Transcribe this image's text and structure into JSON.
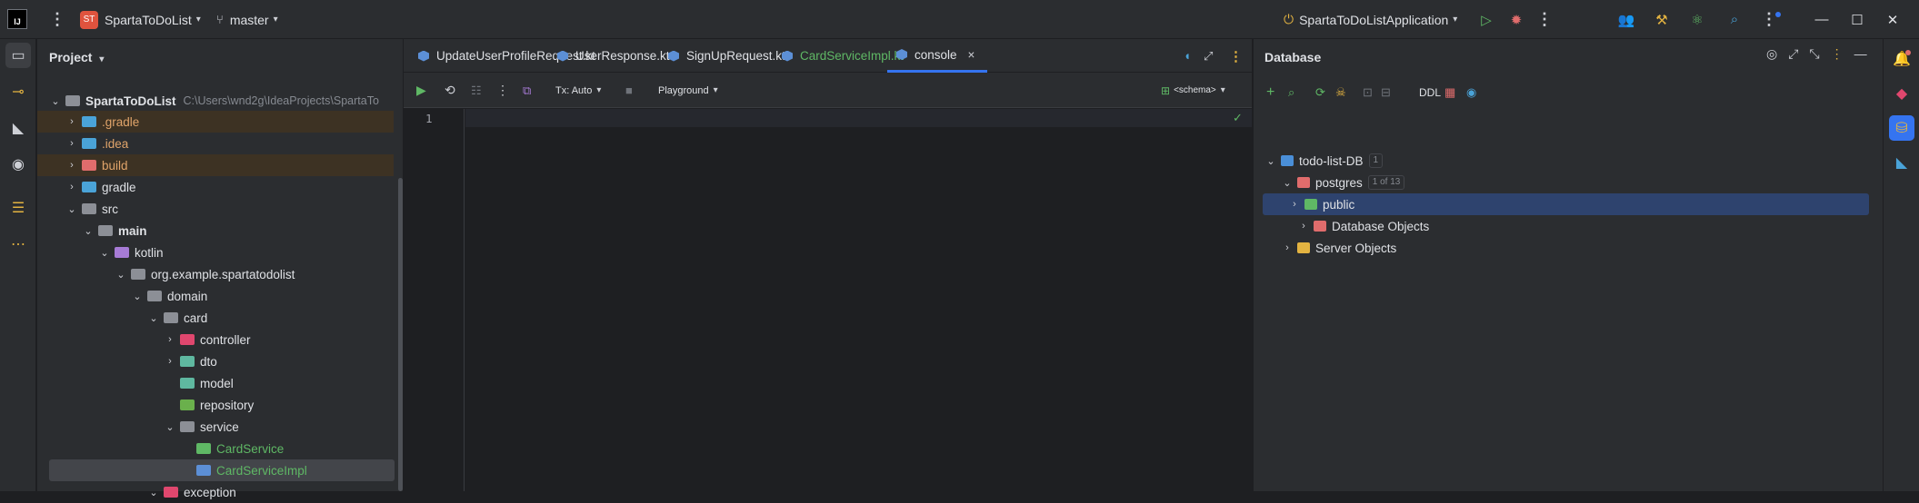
{
  "window": {
    "logo_text": "IJ",
    "project_badge": "ST",
    "project_name": "SpartaToDoList",
    "branch": "master",
    "run_config": "SpartaToDoListApplication"
  },
  "project_panel": {
    "title": "Project",
    "root": {
      "name": "SpartaToDoList",
      "path": "C:\\Users\\wnd2g\\IdeaProjects\\SpartaTo"
    },
    "tree": [
      {
        "label": ".gradle",
        "depth": 1,
        "arrow": "›",
        "color": "#e0a46a",
        "icon": "#4aa3d8",
        "highlight": true
      },
      {
        "label": ".idea",
        "depth": 1,
        "arrow": "›",
        "color": "#e0a46a",
        "icon": "#4aa3d8",
        "highlight": false
      },
      {
        "label": "build",
        "depth": 1,
        "arrow": "›",
        "color": "#e0a46a",
        "icon": "#e06c6c",
        "highlight": true
      },
      {
        "label": "gradle",
        "depth": 1,
        "arrow": "›",
        "color": "#dfe1e5",
        "icon": "#4aa3d8",
        "highlight": false
      },
      {
        "label": "src",
        "depth": 1,
        "arrow": "⌄",
        "color": "#dfe1e5",
        "icon": "#8c8f96",
        "highlight": false
      },
      {
        "label": "main",
        "depth": 2,
        "arrow": "⌄",
        "color": "#dfe1e5",
        "icon": "#8c8f96",
        "bold": true
      },
      {
        "label": "kotlin",
        "depth": 3,
        "arrow": "⌄",
        "color": "#dfe1e5",
        "icon": "#a77bd6"
      },
      {
        "label": "org.example.spartatodolist",
        "depth": 4,
        "arrow": "⌄",
        "color": "#dfe1e5",
        "icon": "#8c8f96"
      },
      {
        "label": "domain",
        "depth": 5,
        "arrow": "⌄",
        "color": "#dfe1e5",
        "icon": "#8c8f96"
      },
      {
        "label": "card",
        "depth": 6,
        "arrow": "⌄",
        "color": "#dfe1e5",
        "icon": "#8c8f96"
      },
      {
        "label": "controller",
        "depth": 7,
        "arrow": "›",
        "color": "#dfe1e5",
        "icon": "#e0476e"
      },
      {
        "label": "dto",
        "depth": 7,
        "arrow": "›",
        "color": "#dfe1e5",
        "icon": "#5fb8a0"
      },
      {
        "label": "model",
        "depth": 7,
        "arrow": "",
        "color": "#dfe1e5",
        "icon": "#5fb8a0"
      },
      {
        "label": "repository",
        "depth": 7,
        "arrow": "",
        "color": "#dfe1e5",
        "icon": "#6ab04c"
      },
      {
        "label": "service",
        "depth": 7,
        "arrow": "⌄",
        "color": "#dfe1e5",
        "icon": "#8c8f96"
      },
      {
        "label": "CardService",
        "depth": 8,
        "arrow": "",
        "color": "#5fb865",
        "icon": "#5fb865"
      },
      {
        "label": "CardServiceImpl",
        "depth": 8,
        "arrow": "",
        "color": "#5fb865",
        "icon": "#5c8fd6",
        "selected": true
      },
      {
        "label": "exception",
        "depth": 6,
        "arrow": "⌄",
        "color": "#dfe1e5",
        "icon": "#e0476e"
      }
    ]
  },
  "editor": {
    "tabs": [
      {
        "label": "UpdateUserProfileRequest.kt",
        "color": "#dfe1e5"
      },
      {
        "label": "UserResponse.kt",
        "color": "#dfe1e5"
      },
      {
        "label": "SignUpRequest.kt",
        "color": "#dfe1e5"
      },
      {
        "label": "CardServiceImpl.kt",
        "color": "#5fb865"
      },
      {
        "label": "console",
        "color": "#dfe1e5",
        "active": true
      }
    ],
    "close_glyph": "×",
    "tx_mode": "Tx: Auto",
    "playground": "Playground",
    "schema": "<schema>",
    "line_number": "1"
  },
  "database_panel": {
    "title": "Database",
    "ddl": "DDL",
    "tree": [
      {
        "label": "todo-list-DB",
        "depth": 0,
        "arrow": "⌄",
        "badge": "1"
      },
      {
        "label": "postgres",
        "depth": 1,
        "arrow": "⌄",
        "badge": "1 of 13"
      },
      {
        "label": "public",
        "depth": 2,
        "arrow": "›",
        "selected": true
      },
      {
        "label": "Database Objects",
        "depth": 2,
        "arrow": "›"
      },
      {
        "label": "Server Objects",
        "depth": 1,
        "arrow": "›"
      }
    ]
  },
  "colors": {
    "accent": "#3574f0",
    "selection": "#2e436e",
    "run_green": "#5fb865",
    "debug_red": "#e06c6c"
  }
}
